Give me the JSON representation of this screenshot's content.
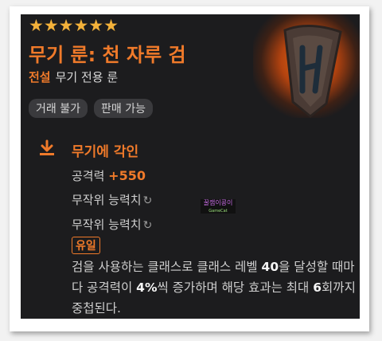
{
  "item": {
    "stars": "★★★★★★",
    "title": "무기 룬: 천 자루 검",
    "grade": "전설",
    "type": "무기 전용 룬",
    "badges": [
      "거래 불가",
      "판매 가능"
    ]
  },
  "section": {
    "title": "무기에 각인",
    "attack_label": "공격력 ",
    "attack_value": "+550",
    "random_stats": [
      "무작위 능력치",
      "무작위 능력치"
    ],
    "unique_label": "유일",
    "desc": {
      "p1": "검을 사용하는 클래스로 클래스 레벨 ",
      "v1": "40",
      "p2": "을 달성할 때마다 공격력이 ",
      "v2": "4%",
      "p3": "씩 증가하며 해당 효과는 최대 ",
      "v3": "6",
      "p4": "회까지 중첩된다."
    }
  },
  "watermark": {
    "text": "꿀잼이콩이",
    "sub": "GameCat"
  },
  "icons": {
    "emblem": "shield-rune-emblem",
    "engrave": "download-arrow-icon",
    "refresh": "refresh-icon"
  },
  "colors": {
    "accent": "#f07a2a",
    "star": "#f3b13a",
    "background": "#1c1c1e"
  }
}
